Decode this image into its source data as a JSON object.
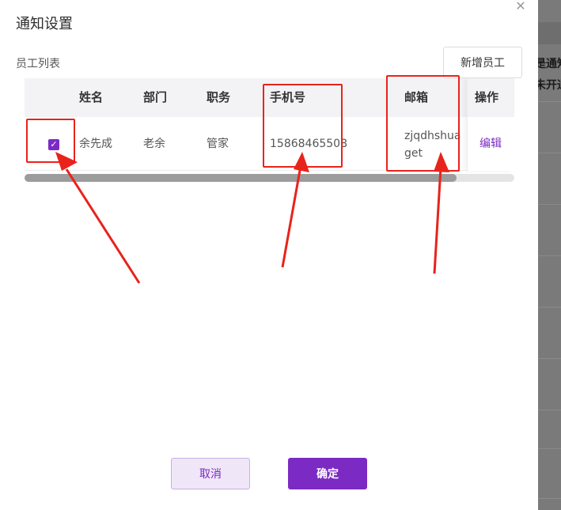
{
  "dialog": {
    "title": "通知设置",
    "section_label": "员工列表",
    "add_button": "新增员工",
    "close_icon": "close-icon"
  },
  "table": {
    "columns": [
      "姓名",
      "部门",
      "职务",
      "手机号",
      "邮箱",
      "操作"
    ],
    "rows": [
      {
        "checked": true,
        "name": "余先成",
        "department": "老余",
        "position": "管家",
        "phone": "15868465508",
        "email": "zjqdhshuaget",
        "action": "编辑"
      }
    ]
  },
  "footer": {
    "cancel_label": "取消",
    "confirm_label": "确定"
  },
  "background": {
    "lines": [
      "是通知",
      "未开通"
    ]
  },
  "colors": {
    "accent": "#7b2bc3",
    "annotation": "#e8231b"
  }
}
